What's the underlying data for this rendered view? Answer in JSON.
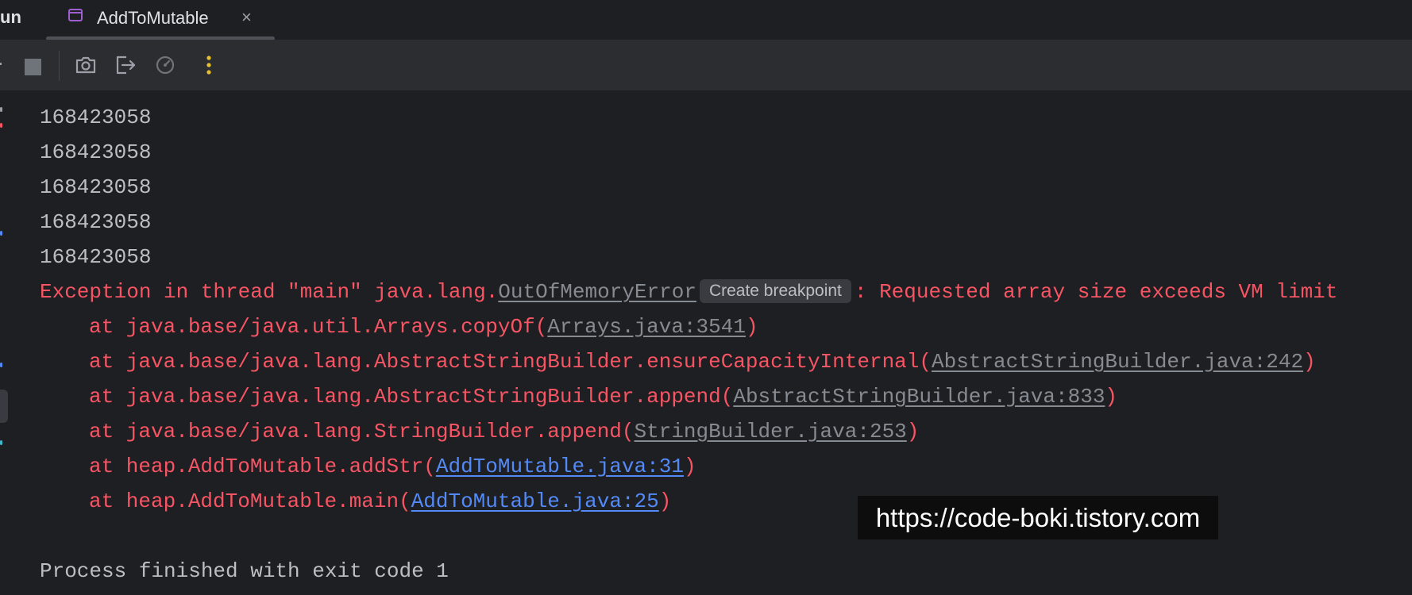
{
  "tabbar": {
    "run_label": "un",
    "tab_title": "AddToMutable",
    "tab_close": "×"
  },
  "toolbar": {
    "icons": [
      "rerun-icon",
      "stop-icon",
      "camera-icon",
      "exit-icon",
      "gauge-icon",
      "more-icon"
    ]
  },
  "console": {
    "output_lines": [
      "168423058",
      "168423058",
      "168423058",
      "168423058",
      "168423058"
    ],
    "exception": {
      "prefix": "Exception in thread \"main\" java.lang.",
      "error_class": "OutOfMemoryError",
      "breakpoint_label": "Create breakpoint",
      "suffix": ": Requested array size exceeds VM limit"
    },
    "stack": [
      {
        "prefix": "at java.base/java.util.Arrays.copyOf(",
        "link": "Arrays.java:3541",
        "suffix": ")"
      },
      {
        "prefix": "at java.base/java.lang.AbstractStringBuilder.ensureCapacityInternal(",
        "link": "AbstractStringBuilder.java:242",
        "suffix": ")"
      },
      {
        "prefix": "at java.base/java.lang.AbstractStringBuilder.append(",
        "link": "AbstractStringBuilder.java:833",
        "suffix": ")"
      },
      {
        "prefix": "at java.base/java.lang.StringBuilder.append(",
        "link": "StringBuilder.java:253",
        "suffix": ")"
      },
      {
        "prefix": "at heap.AddToMutable.addStr(",
        "link": "AddToMutable.java:31",
        "suffix": ")"
      },
      {
        "prefix": "at heap.AddToMutable.main(",
        "link": "AddToMutable.java:25",
        "suffix": ")"
      }
    ],
    "exit_message": "Process finished with exit code 1"
  },
  "watermark": "https://code-boki.tistory.com",
  "colors": {
    "background": "#1e1f22",
    "error_text": "#f75464",
    "plain_text": "#bcbec4",
    "library_link": "#868a91",
    "project_link": "#548af7",
    "tab_icon": "#9e5fcf",
    "more_icon": "#e8c02e"
  }
}
